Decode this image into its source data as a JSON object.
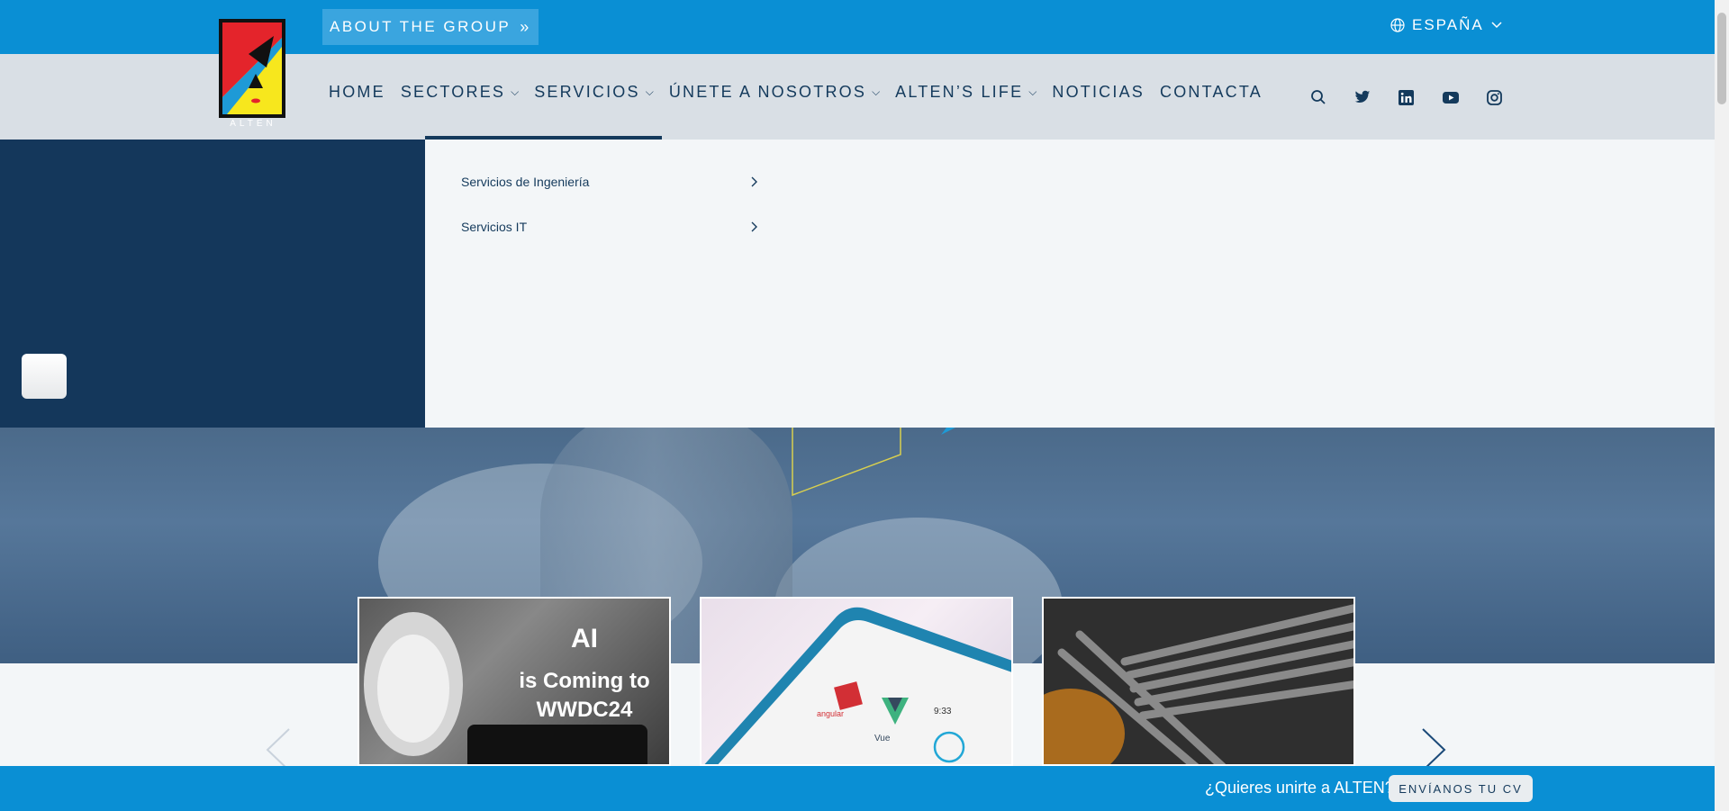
{
  "topbar": {
    "about_label": "ABOUT THE GROUP",
    "about_icon": "double-chevron-right-icon",
    "language_label": "ESPAÑA",
    "language_icon": "globe-icon"
  },
  "logo": {
    "text": "ALTEN"
  },
  "nav": {
    "items": [
      {
        "label": "HOME",
        "dropdown": false
      },
      {
        "label": "SECTORES",
        "dropdown": true
      },
      {
        "label": "SERVICIOS",
        "dropdown": true
      },
      {
        "label": "ÚNETE A NOSOTROS",
        "dropdown": true
      },
      {
        "label": "ALTEN’S LIFE",
        "dropdown": true
      },
      {
        "label": "NOTICIAS",
        "dropdown": false
      },
      {
        "label": "CONTACTA",
        "dropdown": false
      }
    ],
    "active": "SERVICIOS",
    "social_icons": [
      "search-icon",
      "twitter-icon",
      "linkedin-icon",
      "youtube-icon",
      "instagram-icon"
    ]
  },
  "menu": {
    "items": [
      {
        "label": "Servicios de Ingeniería"
      },
      {
        "label": "Servicios IT"
      }
    ]
  },
  "cards": [
    {
      "image": "ai-wwdc24",
      "text_lines": [
        "AI",
        "is Coming to",
        "WWDC24"
      ]
    },
    {
      "image": "phone-frameworks",
      "text_lines": [
        "angular",
        "Vue",
        "9:33"
      ]
    },
    {
      "image": "steel-rebar",
      "text_lines": []
    }
  ],
  "bottombar": {
    "question": "¿Quieres unirte a ALTEN?",
    "cv_button": "ENVÍANOS TU CV"
  },
  "colors": {
    "primary_blue": "#0a8fd4",
    "navy": "#14375b",
    "logo_red": "#e4242b",
    "logo_yellow": "#f7e71d"
  }
}
